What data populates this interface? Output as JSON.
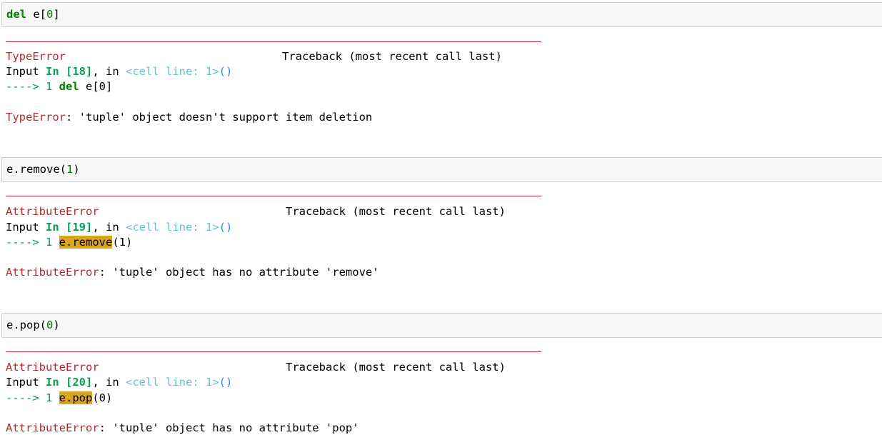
{
  "cells": [
    {
      "input": {
        "kw": "del",
        "rest_a": " e[",
        "num": "0",
        "rest_b": "]"
      },
      "error_name": "TypeError",
      "traceback_header": "Traceback (most recent call last)",
      "input_label": "Input",
      "in_label": "In [18]",
      "in_sep": ", in ",
      "cell_line": "<cell line: 1>",
      "parens": "()",
      "arrow": "----> 1",
      "code_kw": "del",
      "code_hl": "",
      "code_rest": " e[0]",
      "error_msg": ": 'tuple' object doesn't support item deletion"
    },
    {
      "input": {
        "kw": "",
        "rest_a": "e.remove(",
        "num": "1",
        "rest_b": ")"
      },
      "error_name": "AttributeError",
      "traceback_header": "Traceback (most recent call last)",
      "input_label": "Input",
      "in_label": "In [19]",
      "in_sep": ", in ",
      "cell_line": "<cell line: 1>",
      "parens": "()",
      "arrow": "----> 1",
      "code_kw": "",
      "code_hl": "e.remove",
      "code_rest": "(1)",
      "error_msg": ": 'tuple' object has no attribute 'remove'"
    },
    {
      "input": {
        "kw": "",
        "rest_a": "e.pop(",
        "num": "0",
        "rest_b": ")"
      },
      "error_name": "AttributeError",
      "traceback_header": "Traceback (most recent call last)",
      "input_label": "Input",
      "in_label": "In [20]",
      "in_sep": ", in ",
      "cell_line": "<cell line: 1>",
      "parens": "()",
      "arrow": "----> 1",
      "code_kw": "",
      "code_hl": "e.pop",
      "code_rest": "(0)",
      "error_msg": ": 'tuple' object has no attribute 'pop'"
    }
  ],
  "colors": {
    "error": "#b22b31",
    "keyword": "#008000",
    "highlight": "#daa520",
    "cell_line": "#60c6c8",
    "parens": "#208ffb"
  }
}
